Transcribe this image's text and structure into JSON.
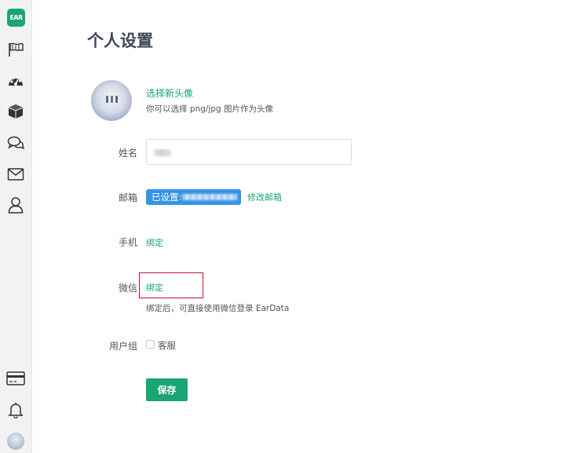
{
  "sidebar": {
    "logo_text": "EAR",
    "items": [
      {
        "icon": "flag-icon"
      },
      {
        "icon": "dashboard-icon"
      },
      {
        "icon": "cube-icon"
      },
      {
        "icon": "chat-icon"
      },
      {
        "icon": "mail-icon"
      },
      {
        "icon": "user-icon"
      }
    ],
    "bottom_items": [
      {
        "icon": "card-icon"
      },
      {
        "icon": "bell-icon"
      },
      {
        "icon": "avatar"
      }
    ]
  },
  "page": {
    "title": "个人设置"
  },
  "avatar_section": {
    "choose_label": "选择新头像",
    "hint": "你可以选择 png/jpg 图片作为头像"
  },
  "form": {
    "name_label": "姓名",
    "email_label": "邮箱",
    "email_status": "已设置:",
    "email_change_label": "修改邮箱",
    "phone_label": "手机",
    "phone_bind_label": "绑定",
    "wechat_label": "微信",
    "wechat_bind_label": "绑定",
    "wechat_hint": "绑定后，可直接使用微信登录 EarData",
    "usergroup_label": "用户组",
    "usergroup_option": "客服",
    "save_label": "保存"
  },
  "colors": {
    "brand_green": "#1aa573",
    "email_badge_blue": "#3694e6",
    "highlight_red": "#c8102e"
  }
}
